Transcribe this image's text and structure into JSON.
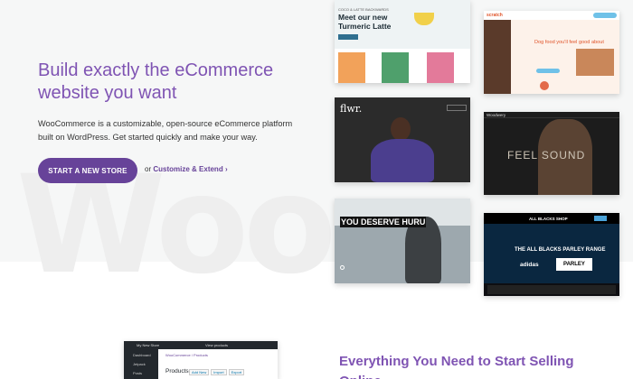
{
  "hero": {
    "title": "Build exactly the eCommerce website you want",
    "description": "WooCommerce is a customizable, open-source eCommerce platform built on WordPress. Get started quickly and make your way.",
    "cta_label": "START A NEW STORE",
    "or_text": "or",
    "secondary_link": "Customize & Extend",
    "chevron": "›",
    "watermark": "Woo"
  },
  "showcase": {
    "latte": {
      "small": "COCO & LATTE BACKWARDS",
      "title": "Meet our new Turmeric Latte"
    },
    "scratch": {
      "logo": "scratch",
      "headline": "Dog food you'll feel good about"
    },
    "flowers": {
      "logo": "flwr."
    },
    "feel_sound": {
      "logo": "Woodwery",
      "headline": "FEEL SOUND"
    },
    "huru": {
      "headline": "YOU DESERVE HURU"
    },
    "all_blacks": {
      "shop": "ALL BLACKS SHOP",
      "range": "THE ALL BLACKS PARLEY RANGE",
      "adidas": "adidas",
      "parley": "PARLEY"
    }
  },
  "admin_preview": {
    "site_name": "My New Store",
    "view_products": "View products",
    "menu": [
      "Dashboard",
      "Jetpack",
      "Posts"
    ],
    "breadcrumb": "WooCommerce / Products",
    "heading": "Products",
    "buttons": [
      "Add New",
      "Import",
      "Export"
    ]
  },
  "features": {
    "title": "Everything You Need to Start Selling Online"
  },
  "colors": {
    "brand_purple": "#7f54b3",
    "button_purple": "#674399"
  }
}
